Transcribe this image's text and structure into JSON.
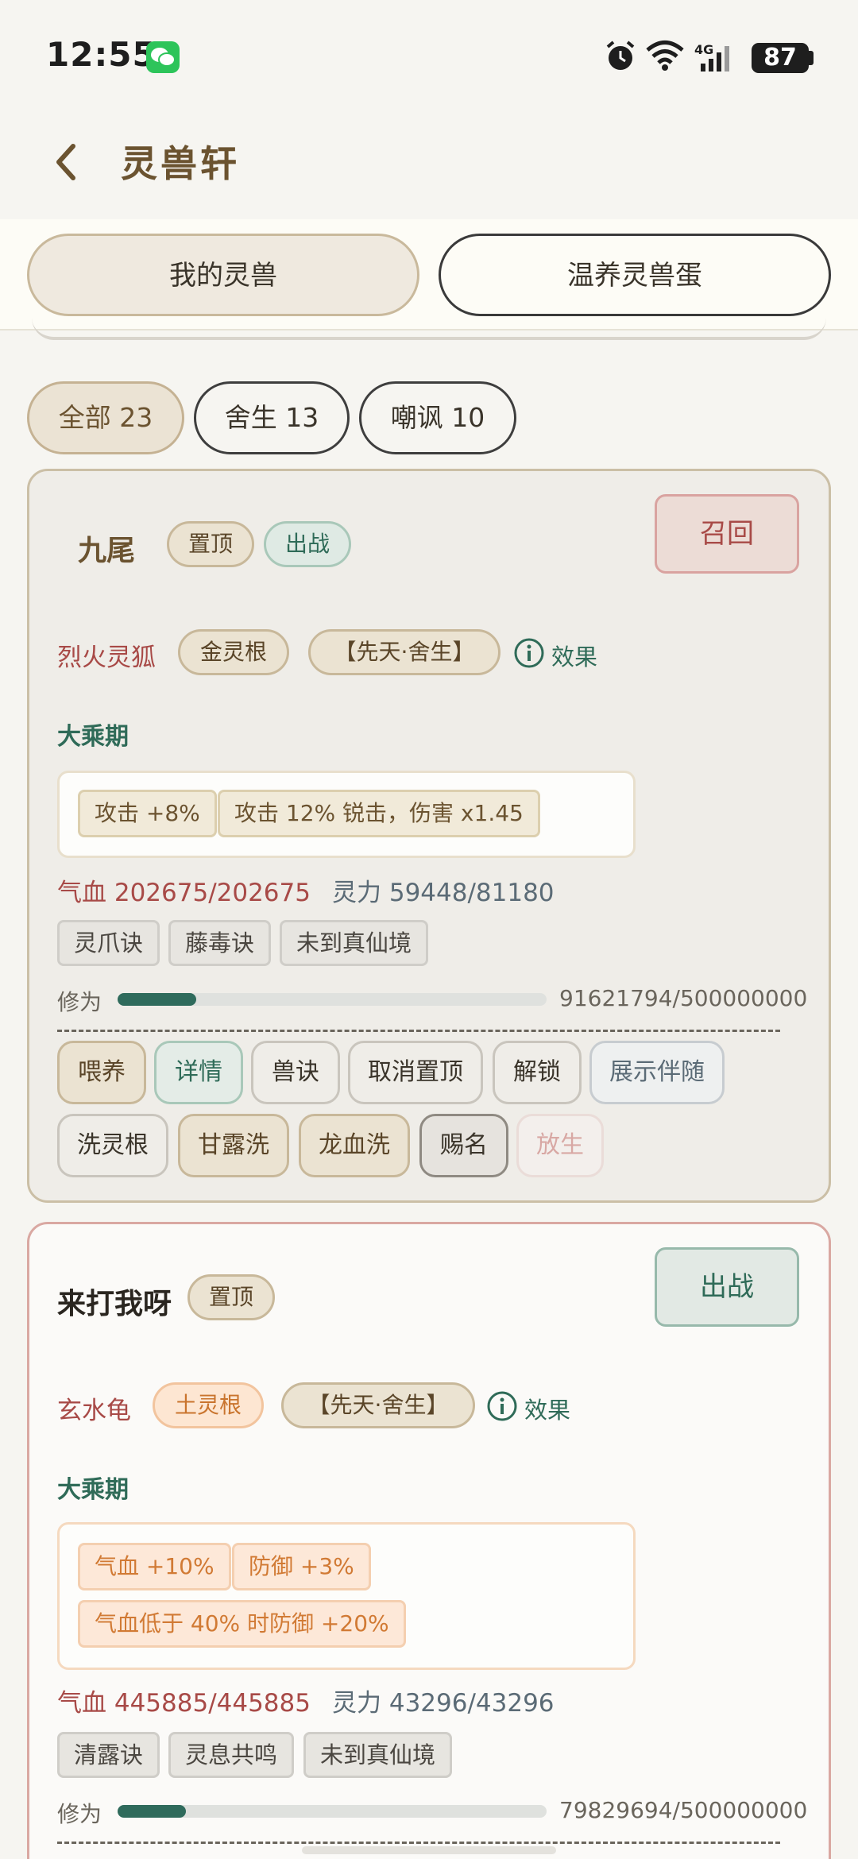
{
  "status_bar": {
    "time": "12:55",
    "network": "4G",
    "battery": "87"
  },
  "header": {
    "title": "灵兽轩"
  },
  "tabs": [
    {
      "label": "我的灵兽"
    },
    {
      "label": "温养灵兽蛋"
    }
  ],
  "filters": [
    {
      "label": "全部 23"
    },
    {
      "label": "舍生 13"
    },
    {
      "label": "嘲讽 10"
    }
  ],
  "pets": [
    {
      "name": "九尾",
      "tags": [
        "置顶",
        "出战"
      ],
      "action_button": "召回",
      "species": "烈火灵狐",
      "root": "金灵根",
      "trait": "【先天·舍生】",
      "effect_label": "效果",
      "realm": "大乘期",
      "buffs": [
        "攻击 +8%",
        "攻击 12% 锐击，伤害 x1.45"
      ],
      "hp_text": "气血 202675/202675",
      "mp_text": "灵力 59448/81180",
      "skills": [
        "灵爪诀",
        "藤毒诀",
        "未到真仙境"
      ],
      "cultivation_label": "修为",
      "cultivation_value": "91621794/500000000",
      "cultivation_progress": 0.183,
      "actions_row1": [
        "喂养",
        "详情",
        "兽诀",
        "取消置顶",
        "解锁",
        "展示伴随"
      ],
      "actions_row2": [
        "洗灵根",
        "甘露洗",
        "龙血洗",
        "赐名",
        "放生"
      ]
    },
    {
      "name": "来打我呀",
      "tags": [
        "置顶"
      ],
      "action_button": "出战",
      "species": "玄水龟",
      "root": "土灵根",
      "trait": "【先天·舍生】",
      "effect_label": "效果",
      "realm": "大乘期",
      "buffs": [
        "气血 +10%",
        "防御 +3%",
        "气血低于 40% 时防御 +20%"
      ],
      "hp_text": "气血 445885/445885",
      "mp_text": "灵力 43296/43296",
      "skills": [
        "清露诀",
        "灵息共鸣",
        "未到真仙境"
      ],
      "cultivation_label": "修为",
      "cultivation_value": "79829694/500000000",
      "cultivation_progress": 0.16
    }
  ],
  "colors": {
    "accent_gold": "#6b5330",
    "accent_teal": "#2f6b58",
    "accent_red": "#a84a47",
    "background": "#f6f5f1"
  }
}
